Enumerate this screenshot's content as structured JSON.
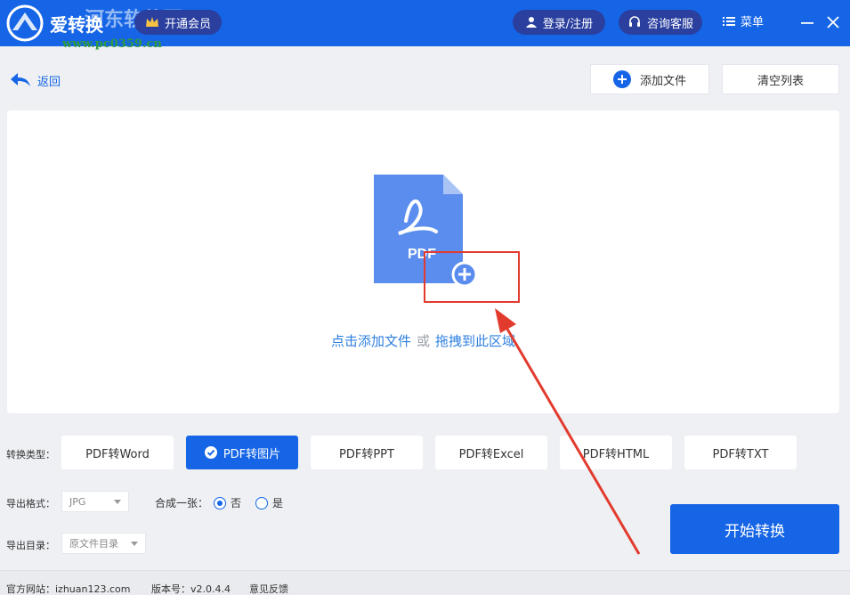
{
  "titlebar": {
    "app_name": "爱转换",
    "watermark": "河东软件园",
    "watermark_url": "www.pc0359.cn",
    "vip_label": "开通会员",
    "login_label": "登录/注册",
    "service_label": "咨询客服",
    "menu_label": "菜单"
  },
  "toolbar": {
    "back_label": "返回",
    "add_file_label": "添加文件",
    "clear_list_label": "清空列表"
  },
  "dropzone": {
    "file_badge": "PDF",
    "click_add": "点击添加文件",
    "or": "或",
    "drag_here": "拖拽到此区域"
  },
  "options": {
    "type_label": "转换类型：",
    "types": [
      {
        "label": "PDF转Word",
        "active": false
      },
      {
        "label": "PDF转图片",
        "active": true
      },
      {
        "label": "PDF转PPT",
        "active": false
      },
      {
        "label": "PDF转Excel",
        "active": false
      },
      {
        "label": "PDF转HTML",
        "active": false
      },
      {
        "label": "PDF转TXT",
        "active": false
      }
    ],
    "format_label": "导出格式：",
    "format_value": "JPG",
    "merge_label": "合成一张：",
    "merge_no": "否",
    "merge_yes": "是",
    "merge_selected": "否",
    "dir_label": "导出目录：",
    "dir_value": "原文件目录",
    "start_label": "开始转换"
  },
  "footer": {
    "site": "官方网站：izhuan123.com",
    "version": "版本号：v2.0.4.4",
    "feedback": "意见反馈"
  },
  "colors": {
    "brand": "#1565e6",
    "pill": "#2a3f9e",
    "link": "#2d7fe0",
    "annotation": "#e23b2e"
  }
}
